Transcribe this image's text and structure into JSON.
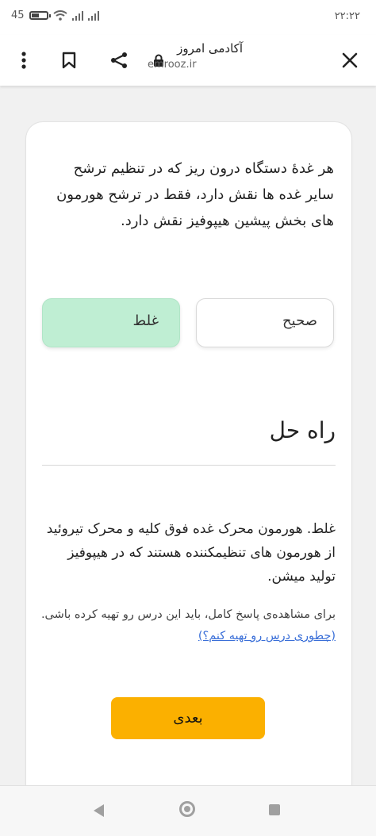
{
  "status_bar": {
    "battery": "45",
    "time": "۲۲:۲۲"
  },
  "browser": {
    "page_title": "آکادمی امروز",
    "url": "emrooz.ir"
  },
  "quiz": {
    "question": "هر غدهٔ دستگاه درون ریز که در تنظیم ترشح سایر غده ها نقش دارد، فقط در ترشح هورمون های بخش پیشین هیپوفیز نقش دارد.",
    "options": [
      {
        "label": "صحیح",
        "selected": false
      },
      {
        "label": "غلط",
        "selected": true
      }
    ]
  },
  "solution": {
    "title": "راه حل",
    "text": "غلط. هورمون محرک غده فوق کلیه و محرک تیروئید از هورمون های تنظیمکننده هستند که در هیپوفیز تولید میشن.",
    "note_prefix": "برای مشاهده‌ی پاسخ کامل، باید این درس رو تهیه کرده باشی.",
    "note_link": "(چطوری درس رو تهیه کنم؟)"
  },
  "next_button": {
    "label": "بعدی"
  },
  "colors": {
    "selected_answer_bg": "#bfeed3",
    "next_button_bg": "#fbb000",
    "link": "#3a6fd8"
  },
  "icons": {
    "close": "close-icon",
    "lock": "lock-icon",
    "share": "share-icon",
    "bookmark": "bookmark-icon",
    "menu": "more-vert-icon"
  }
}
